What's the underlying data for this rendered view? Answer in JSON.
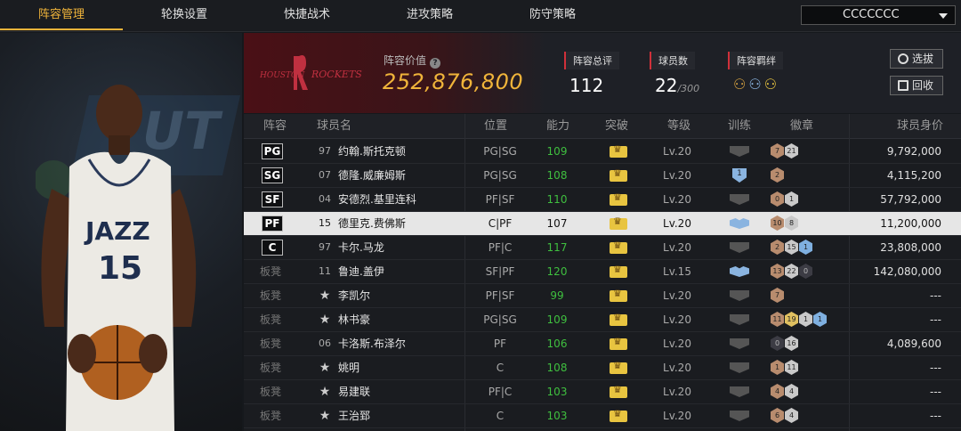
{
  "tabs": [
    "阵容管理",
    "轮换设置",
    "快捷战术",
    "进攻策略",
    "防守策略"
  ],
  "team_select": "CCCCCCC",
  "header": {
    "team_logo_text": "HOUSTON ROCKETS",
    "value_label": "阵容价值",
    "value": "252,876,800",
    "overall_label": "阵容总评",
    "overall": "112",
    "player_count_label": "球员数",
    "player_count": "22",
    "player_count_max": "/300",
    "bond_label": "阵容羁绊",
    "btn_select": "选拔",
    "btn_recall": "回收"
  },
  "player_panel": {
    "jersey_team": "JAZZ",
    "jersey_number": "15"
  },
  "columns": [
    "阵容",
    "球员名",
    "位置",
    "能力",
    "突破",
    "等级",
    "训练",
    "徽章",
    "球员身价"
  ],
  "rows": [
    {
      "slot": "PG",
      "bench": false,
      "num": "97",
      "name": "约翰.斯托克顿",
      "pos": "PG|SG",
      "ability": "109",
      "level": "Lv.20",
      "train": "gray",
      "badges": [
        [
          "bronze",
          "7"
        ],
        [
          "silver",
          "21"
        ]
      ],
      "value": "9,792,000",
      "selected": false
    },
    {
      "slot": "SG",
      "bench": false,
      "num": "07",
      "name": "德隆.威廉姆斯",
      "pos": "PG|SG",
      "ability": "108",
      "level": "Lv.20",
      "train": "shield1",
      "badges": [
        [
          "bronze",
          "2"
        ]
      ],
      "value": "4,115,200",
      "selected": false
    },
    {
      "slot": "SF",
      "bench": false,
      "num": "04",
      "name": "安德烈.基里连科",
      "pos": "PF|SF",
      "ability": "110",
      "level": "Lv.20",
      "train": "gray",
      "badges": [
        [
          "bronze",
          "0"
        ],
        [
          "silver",
          "1"
        ]
      ],
      "value": "57,792,000",
      "selected": false
    },
    {
      "slot": "PF",
      "bench": false,
      "num": "15",
      "name": "德里克.费佛斯",
      "pos": "C|PF",
      "ability": "107",
      "level": "Lv.20",
      "train": "blue",
      "badges": [
        [
          "bronze",
          "10"
        ],
        [
          "silver",
          "8"
        ]
      ],
      "value": "11,200,000",
      "selected": true
    },
    {
      "slot": "C",
      "bench": false,
      "num": "97",
      "name": "卡尔.马龙",
      "pos": "PF|C",
      "ability": "117",
      "level": "Lv.20",
      "train": "gray",
      "badges": [
        [
          "bronze",
          "2"
        ],
        [
          "silver",
          "15"
        ],
        [
          "blue",
          "1"
        ]
      ],
      "value": "23,808,000",
      "selected": false
    },
    {
      "slot": "板凳",
      "bench": true,
      "num": "11",
      "name": "鲁迪.盖伊",
      "pos": "SF|PF",
      "ability": "120",
      "level": "Lv.15",
      "train": "blue",
      "badges": [
        [
          "bronze",
          "13"
        ],
        [
          "silver",
          "22"
        ],
        [
          "dark",
          "0"
        ]
      ],
      "value": "142,080,000",
      "selected": false
    },
    {
      "slot": "板凳",
      "bench": true,
      "num": "★",
      "name": "李凯尔",
      "pos": "PF|SF",
      "ability": "99",
      "level": "Lv.20",
      "train": "gray",
      "badges": [
        [
          "bronze",
          "7"
        ]
      ],
      "value": "---",
      "selected": false
    },
    {
      "slot": "板凳",
      "bench": true,
      "num": "★",
      "name": "林书豪",
      "pos": "PG|SG",
      "ability": "109",
      "level": "Lv.20",
      "train": "gray",
      "badges": [
        [
          "bronze",
          "11"
        ],
        [
          "gold",
          "19"
        ],
        [
          "silver",
          "1"
        ],
        [
          "blue",
          "1"
        ]
      ],
      "value": "---",
      "selected": false
    },
    {
      "slot": "板凳",
      "bench": true,
      "num": "06",
      "name": "卡洛斯.布泽尔",
      "pos": "PF",
      "ability": "106",
      "level": "Lv.20",
      "train": "gray",
      "badges": [
        [
          "dark",
          "0"
        ],
        [
          "silver",
          "16"
        ]
      ],
      "value": "4,089,600",
      "selected": false
    },
    {
      "slot": "板凳",
      "bench": true,
      "num": "★",
      "name": "姚明",
      "pos": "C",
      "ability": "108",
      "level": "Lv.20",
      "train": "gray",
      "badges": [
        [
          "bronze",
          "1"
        ],
        [
          "silver",
          "11"
        ]
      ],
      "value": "---",
      "selected": false
    },
    {
      "slot": "板凳",
      "bench": true,
      "num": "★",
      "name": "易建联",
      "pos": "PF|C",
      "ability": "103",
      "level": "Lv.20",
      "train": "gray",
      "badges": [
        [
          "bronze",
          "4"
        ],
        [
          "silver",
          "4"
        ]
      ],
      "value": "---",
      "selected": false
    },
    {
      "slot": "板凳",
      "bench": true,
      "num": "★",
      "name": "王治郅",
      "pos": "C",
      "ability": "103",
      "level": "Lv.20",
      "train": "gray",
      "badges": [
        [
          "bronze",
          "6"
        ],
        [
          "silver",
          "4"
        ]
      ],
      "value": "---",
      "selected": false
    }
  ]
}
